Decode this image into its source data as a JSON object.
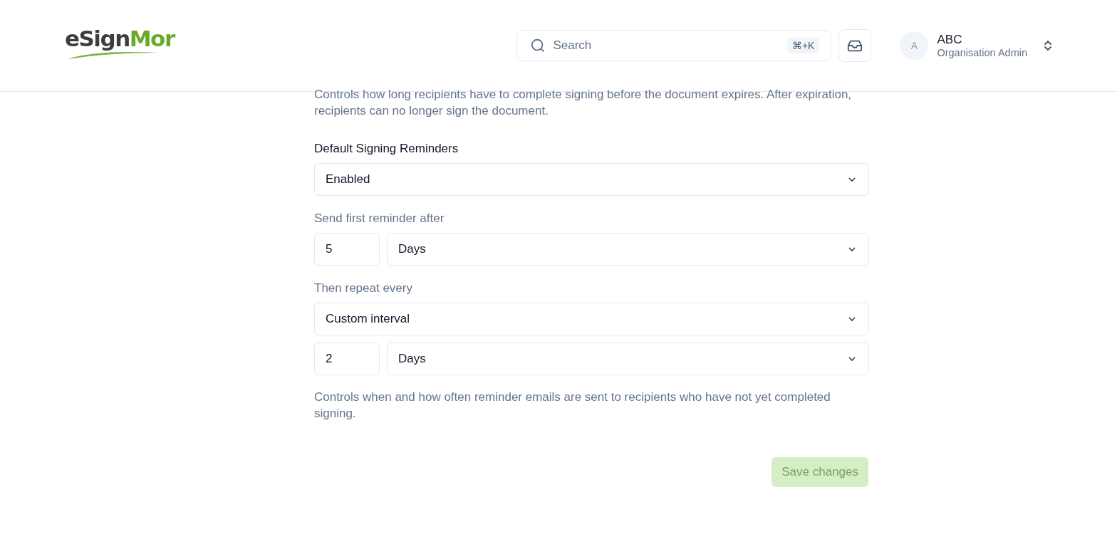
{
  "header": {
    "logo": {
      "text": "eSign",
      "accent": "Mor"
    },
    "search": {
      "placeholder": "Search",
      "shortcut": "⌘+K"
    },
    "user": {
      "avatar": "A",
      "name": "ABC",
      "role": "Organisation Admin"
    }
  },
  "expiry_help": "Controls how long recipients have to complete signing before the document expires. After expiration, recipients can no longer sign the document.",
  "reminders": {
    "label": "Default Signing Reminders",
    "mode": "Enabled",
    "first": {
      "label": "Send first reminder after",
      "amount": "5",
      "unit": "Days"
    },
    "repeat": {
      "label": "Then repeat every",
      "mode": "Custom interval",
      "amount": "2",
      "unit": "Days"
    },
    "help": "Controls when and how often reminder emails are sent to recipients who have not yet completed signing."
  },
  "save_button": {
    "label": "Save changes",
    "disabled": true
  }
}
